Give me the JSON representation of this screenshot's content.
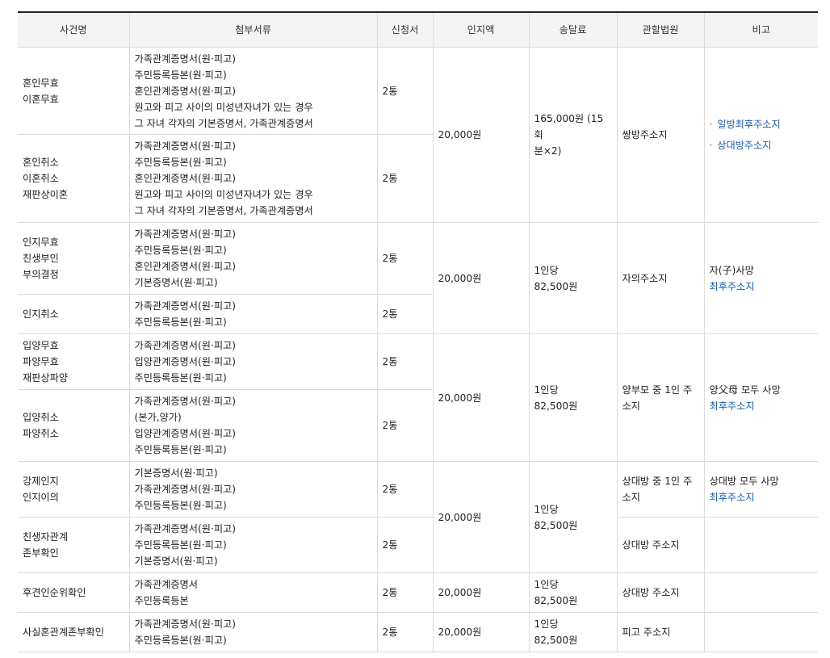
{
  "headers": [
    "사건명",
    "첨부서류",
    "신청서",
    "인지액",
    "송달료",
    "관할법원",
    "비고"
  ],
  "rows": {
    "r1": {
      "case": [
        "혼인무효",
        "이혼무효"
      ],
      "docs": [
        "가족관계증명서(원·피고)",
        "주민등록등본(원·피고)",
        "혼인관계증명서(원·피고)",
        "원고와 피고 사이의  미성년자녀가 있는 경우",
        "그 자녀 각자의 기본증명서, 가족관계증명서"
      ],
      "app": "2통"
    },
    "r2": {
      "case": [
        "혼인취소",
        "이혼취소",
        "재판상이혼"
      ],
      "docs": [
        "가족관계증명서(원·피고)",
        "주민등록등본(원·피고)",
        "혼인관계증명서(원·피고)",
        "원고와 피고 사이의  미성년자녀가 있는 경우",
        "그 자녀 각자의 기본증명서, 가족관계증명서"
      ],
      "app": "2통"
    },
    "r3": {
      "case": [
        "인지무효",
        "친생부인",
        "부의결정"
      ],
      "docs": [
        "가족관계증명서(원·피고)",
        "주민등록등본(원·피고)",
        "혼인관계증명서(원·피고)",
        "기본증명서(원·피고)"
      ],
      "app": "2통"
    },
    "r4": {
      "case": [
        "인지취소"
      ],
      "docs": [
        "가족관계증명서(원·피고)",
        "주민등록등본(원·피고)"
      ],
      "app": "2통"
    },
    "r5": {
      "case": [
        "입양무효",
        "파양무효",
        "재판상파양"
      ],
      "docs": [
        "가족관계증명서(원·피고)",
        "입양관계증명서(원·피고)",
        "주민등록등본(원·피고)"
      ],
      "app": "2통"
    },
    "r6": {
      "case": [
        "입양취소",
        "파양취소"
      ],
      "docs": [
        "가족관계증명서(원·피고)",
        "(본가,양가)",
        "입양관계증명서(원·피고)",
        "주민등록등본(원·피고)"
      ],
      "app": "2통"
    },
    "r7": {
      "case": [
        "강제인지",
        "인지이의"
      ],
      "docs": [
        "기본증명서(원·피고)",
        "가족관계증명서(원·피고)",
        "주민등록등본(원·피고)"
      ],
      "app": "2통",
      "court": "상대방 중 1인 주소지",
      "note": [
        "상대방 모두  사망",
        "최후주소지"
      ]
    },
    "r8": {
      "case": [
        "친생자관계",
        "존부확인"
      ],
      "docs": [
        "가족관계증명서(원·피고)",
        "주민등록등본(원·피고)",
        "기본증명서(원·피고)"
      ],
      "app": "2통",
      "court": "상대방 주소지"
    },
    "r9": {
      "case": [
        "후견인순위확인"
      ],
      "docs": [
        "가족관계증명서",
        "주민등록등본"
      ],
      "app": "2통",
      "fee": "20,000원",
      "postage": [
        "1인당",
        "82,500원"
      ],
      "court": "상대방 주소지"
    },
    "r10": {
      "case": [
        "사실혼관계존부확인"
      ],
      "docs": [
        "가족관계증명서(원·피고)",
        "주민등록등본(원·피고)"
      ],
      "app": "2통",
      "fee": "20,000원",
      "postage": [
        "1인당",
        "82,500원"
      ],
      "court": "피고 주소지"
    }
  },
  "groups": {
    "g1": {
      "fee": "20,000원",
      "postage": [
        "165,000원 (15회",
        "분×2)"
      ],
      "court": "쌍방주소지",
      "note": [
        "일방최후주소지",
        "상대방주소지"
      ]
    },
    "g2": {
      "fee": "20,000원",
      "postage": [
        "1인당",
        "82,500원"
      ],
      "court": "자의주소지",
      "note": [
        "자(子)사망",
        "최후주소지"
      ]
    },
    "g3": {
      "fee": "20,000원",
      "postage": [
        "1인당",
        "82,500원"
      ],
      "court": "양부모 중 1인 주소지",
      "note": [
        "양父母 모두  사망",
        "최후주소지"
      ]
    },
    "g4": {
      "fee": "20,000원",
      "postage": [
        "1인당",
        "82,500원"
      ]
    }
  }
}
